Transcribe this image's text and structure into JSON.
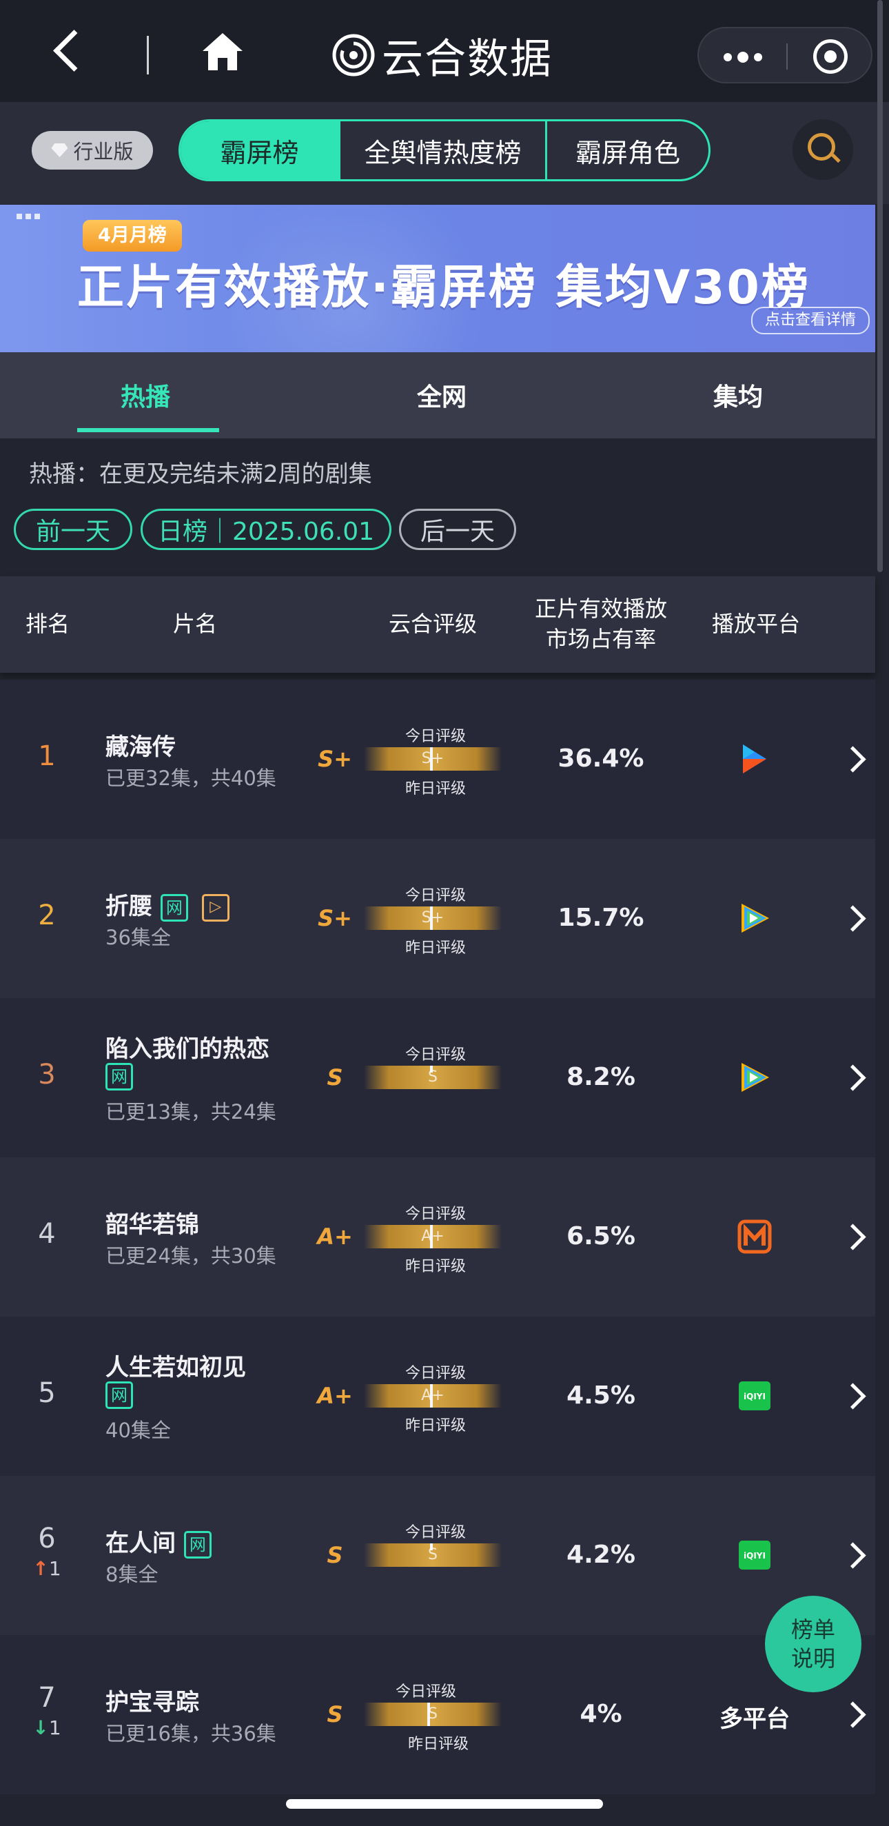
{
  "topbar": {
    "brand": "云合数据"
  },
  "subbar": {
    "industry_label": "行业版",
    "segments": [
      "霸屏榜",
      "全舆情热度榜",
      "霸屏角色"
    ]
  },
  "banner": {
    "tag": "4月月榜",
    "title": "正片有效播放·霸屏榜 集均V30榜",
    "detail": "点击查看详情"
  },
  "tabs": [
    "热播",
    "全网",
    "集均"
  ],
  "description": "热播：在更及完结未满2周的剧集",
  "date_controls": {
    "prev": "前一天",
    "current": "日榜｜2025.06.01",
    "next": "后一天"
  },
  "table_header": {
    "rank": "排名",
    "title": "片名",
    "rating": "云合评级",
    "share_line1": "正片有效播放",
    "share_line2": "市场占有率",
    "platform": "播放平台"
  },
  "rating_labels": {
    "today": "今日评级",
    "yesterday": "昨日评级"
  },
  "rows": [
    {
      "rank": "1",
      "title": "藏海传",
      "badge_net": "",
      "badge_play": "",
      "sub": "已更32集，共40集",
      "grade": "S+",
      "today": "S+",
      "show_yesterday": true,
      "share": "36.4%",
      "platform": "youku",
      "change": ""
    },
    {
      "rank": "2",
      "title": "折腰",
      "badge_net": "网",
      "badge_play": "▷",
      "sub": "36集全",
      "grade": "S+",
      "today": "S+",
      "show_yesterday": true,
      "share": "15.7%",
      "platform": "tencent",
      "change": ""
    },
    {
      "rank": "3",
      "title": "陷入我们的热恋",
      "badge_net": "网",
      "badge_play": "",
      "sub": "已更13集，共24集",
      "grade": "S",
      "today": "S",
      "show_yesterday": false,
      "share": "8.2%",
      "platform": "tencent",
      "change": ""
    },
    {
      "rank": "4",
      "title": "韶华若锦",
      "badge_net": "",
      "badge_play": "",
      "sub": "已更24集，共30集",
      "grade": "A+",
      "today": "A+",
      "show_yesterday": true,
      "share": "6.5%",
      "platform": "mango",
      "change": ""
    },
    {
      "rank": "5",
      "title": "人生若如初见",
      "badge_net": "网",
      "badge_play": "",
      "sub": "40集全",
      "grade": "A+",
      "today": "A+",
      "show_yesterday": true,
      "share": "4.5%",
      "platform": "iqiyi",
      "change": ""
    },
    {
      "rank": "6",
      "title": "在人间",
      "badge_net": "网",
      "badge_play": "",
      "sub": "8集全",
      "grade": "S",
      "today": "S",
      "show_yesterday": false,
      "share": "4.2%",
      "platform": "iqiyi",
      "change": "1",
      "change_dir": "up"
    },
    {
      "rank": "7",
      "title": "护宝寻踪",
      "badge_net": "",
      "badge_play": "",
      "sub": "已更16集，共36集",
      "grade": "S",
      "today": "S",
      "show_yesterday": true,
      "share": "4%",
      "platform_text": "多平台",
      "change": "1",
      "change_dir": "down"
    }
  ],
  "fab": {
    "line1": "榜单",
    "line2": "说明"
  },
  "colors": {
    "accent": "#2ee3b4",
    "grade": "#f0a73c",
    "up": "#ef6a3c",
    "down": "#3cc98a"
  },
  "icons": {
    "back": "chevron-left-icon",
    "home": "home-icon",
    "more": "more-dots-icon",
    "close": "target-icon",
    "search": "search-icon"
  }
}
